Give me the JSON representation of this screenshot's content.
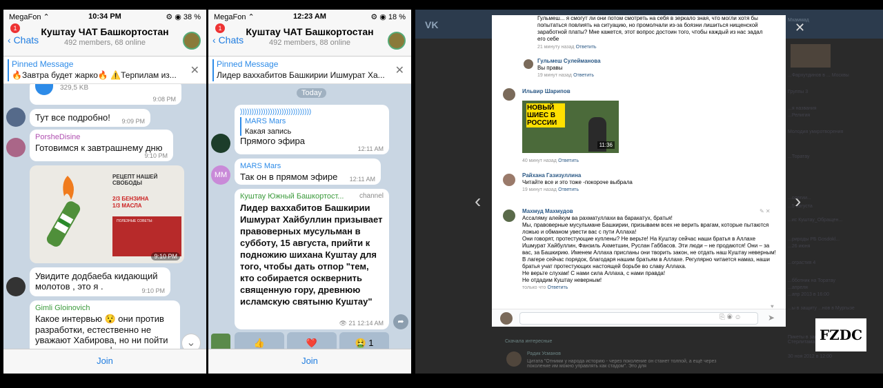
{
  "left": {
    "status": {
      "carrier": "MegaFon ⌃",
      "time": "10:34 PM",
      "battery": "⚙ ◉ 38 %"
    },
    "badge": "1",
    "back": "Chats",
    "title": "Куштау ЧАТ Башкортостан",
    "subtitle": "492 members, 68 online",
    "pin_title": "Pinned Message",
    "pin_text": "🔥Завтра будет жарко🔥 ⚠️Терпилам из...",
    "file_size": "329,5 KB",
    "file_time": "9:08 PM",
    "msg1": "Тут все подробно!",
    "msg1_time": "9:09 PM",
    "msg2_name": "PorsheDisine",
    "msg2": "Готовимся к завтрашнему дню",
    "msg2_time": "9:10 PM",
    "img_heading": "РЕЦЕПТ НАШЕЙ СВОБОДЫ",
    "img_l1": "2/3 БЕНЗИНА",
    "img_l2": "1/3 МАСЛА",
    "img_tips": "ПОЛЕЗНЫЕ СОВЕТЫ:",
    "img_time": "9:10 PM",
    "msg3": "Увидите додбаеба кидающий молотов , это я .",
    "msg3_time": "9:10 PM",
    "msg4_name": "Gimli Gloinovich",
    "msg4": "Какое интервью 😯 они против разработки, естественно не уважают Хабирова, но ни пойти против, ни дать официальное",
    "join": "Join"
  },
  "right": {
    "status": {
      "carrier": "MegaFon ⌃",
      "time": "12:23 AM",
      "battery": "⚙ ◉ 18 %"
    },
    "badge": "1",
    "back": "Chats",
    "title": "Куштау ЧАТ Башкортостан",
    "subtitle": "492 members, 88 online",
    "pin_title": "Pinned Message",
    "pin_text": "Лидер ваххабитов Башкирии Ишмурат Ха...",
    "today": "Today",
    "voice": ")))))))))))))))))))))))))))))))",
    "reply_name": "MARS Mars",
    "reply_text": "Какая запись",
    "r1": "Прямого эфира",
    "r1_time": "12:11 AM",
    "mm": "MM",
    "m2_name": "MARS Mars",
    "m2": "Так он в прямом эфире",
    "m2_time": "12:11 AM",
    "ch_name": "Куштау Южный Башкортост...",
    "ch_tag": "channel",
    "ch_text": "Лидер ваххабитов Башкирии Ишмурат Хайбуллин призывает правоверных мусульман в субботу, 15 августа, прийти к подножию шихана Куштау для того, чтобы дать отпор \"тем, кто собирается осквернить священную гору, древнюю исламскую святыню Куштау\"",
    "ch_meta": "👁 21 12:14 AM",
    "reactions": [
      "👍",
      "❤️",
      "🤮 1"
    ],
    "join": "Join"
  },
  "vk": {
    "logo": "VK",
    "c0": "Гульмеш... я смогут ли они потом смотреть на себя в зеркало зная, что могли хотя бы попытаться повлиять на ситуацию, но промолчали из-за боязни лишиться нищенской заработной платы? Мне кажется, этот вопрос достоин того, чтобы каждый из нас задал его себе",
    "c0_m": "21 минуту назад",
    "reply": "Ответить",
    "c1_n": "Гульмеш Сулейманова",
    "c1": "Вы правы",
    "c1_m": "19 минут назад",
    "c2_n": "Ильвир Шарипов",
    "c2_img": "НОВЫЙ ШИЕС В РОССИИ",
    "c2_dur": "11:36",
    "c2_m": "40 минут назад",
    "c3_n": "Райхана Газизуллина",
    "c3": "Читайте все и это тоже -покороче выбрала",
    "c3_m": "19 минут назад",
    "c4_n": "Махмуд Махмудов",
    "c4": [
      "Ассаляму алейкум ва рахматуллахи ва баракатух, братья!",
      "Мы, правоверные мусульмане Башкирии, призываем всех не верить врагам, которые пытаются ложью и обманом увести вас с пути Аллаха!",
      "Они говорят, протестующие куплены? Не верьте! На Куштау сейчас наши братья в Аллахе Ишмурат Хайбуллин, Фанзиль Ахметшин, Руслан Габбасов. Эти люди – не продаются! Они – за вас, за Башкирию. Именем Аллаха присланы они творить закон, не отдать наш Куштау неверным!",
      "В лагере сейчас порядок, благодаря нашим братьям в Аллахе. Регулярно читается намаз, наши братья учат протестующих настоящей борьбе во славу Аллаха.",
      "Не верьте слухам! С нами сила Аллаха, с нами правда!",
      "Не отдадим Куштау неверным!"
    ],
    "c4_m": "только что",
    "bg": [
      "Мхаммад",
      "...Фархутдинов в ... Москвы",
      "Группы 3",
      "...я названия",
      "...Религия",
      "Молодия умкротворения",
      "...",
      "...Торатау",
      "...",
      "...ологии...",
      "...5 августа",
      "...ис Куштау_Обращен...",
      "...",
      "...рироды РБ Gosdokl...",
      "...26 июня",
      "...ограстия 4",
      "...бботник на Торатау",
      "...апреля",
      "...апр 2013 в 16:00",
      "...ы в защиту ...нов в Мургызе",
      "...",
      "Пикеты в защиту Шиханов в Стерлитамаке. Инициатив...",
      "30 ноя 2012 в 12:00"
    ],
    "more": "Скачала интересные",
    "bg_name": "Радик Усманов",
    "bg_text": "Цитата \"Отними у народа историю - через поколение он станет толпой, а ещё через поколение им можно управлять как стадом\". Это для",
    "close": "✕",
    "prev": "‹",
    "next": "›",
    "brand": "FZDC"
  }
}
